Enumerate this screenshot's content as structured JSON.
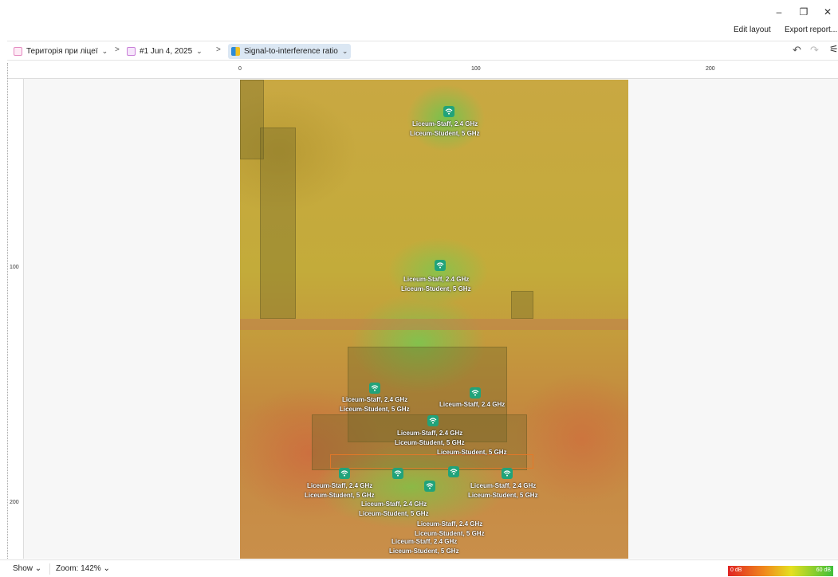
{
  "window": {
    "minimize": "–",
    "maximize": "❐",
    "close": "✕"
  },
  "actions": {
    "edit_layout": "Edit layout",
    "export_report": "Export report..."
  },
  "breadcrumb": {
    "site": "Територія при ліцеї",
    "survey": "#1 Jun 4, 2025",
    "visualization": "Signal-to-interference ratio",
    "separator": ">",
    "chevron": "⌄"
  },
  "toolbar": {
    "undo": "↶",
    "redo": "↷",
    "settings": "⚟"
  },
  "ruler": {
    "top": [
      "0",
      "100",
      "200"
    ],
    "left": [
      "100",
      "200"
    ]
  },
  "access_points": [
    {
      "labels": [
        "Liceum-Staff, 2.4 GHz",
        "Liceum-Student, 5 GHz"
      ]
    },
    {
      "labels": [
        "Liceum-Staff, 2.4 GHz",
        "Liceum-Student, 5 GHz"
      ]
    },
    {
      "labels": [
        "Liceum-Staff, 2.4 GHz",
        "Liceum-Student, 5 GHz"
      ]
    },
    {
      "labels": [
        "Liceum-Staff, 2.4 GHz"
      ]
    },
    {
      "labels": [
        "Liceum-Staff, 2.4 GHz",
        "Liceum-Student, 5 GHz"
      ]
    },
    {
      "labels": [
        "Liceum-Student, 5 GHz"
      ]
    },
    {
      "labels": [
        "Liceum-Staff, 2.4 GHz",
        "Liceum-Student, 5 GHz"
      ]
    },
    {
      "labels": [
        "Liceum-Staff, 2.4 GHz",
        "Liceum-Student, 5 GHz"
      ]
    },
    {
      "labels": [
        "Liceum-Staff, 2.4 GHz",
        "Liceum-Student, 5 GHz"
      ]
    },
    {
      "labels": [
        "Liceum-Staff, 2.4 GHz",
        "Liceum-Student, 5 GHz"
      ]
    },
    {
      "labels": [
        "Liceum-Staff, 2.4 GHz",
        "Liceum-Student, 5 GHz"
      ]
    }
  ],
  "status": {
    "show": "Show",
    "zoom": "Zoom: 142%",
    "chevron": "⌄"
  },
  "legend": {
    "min": "0 dB",
    "max": "60 dB"
  }
}
